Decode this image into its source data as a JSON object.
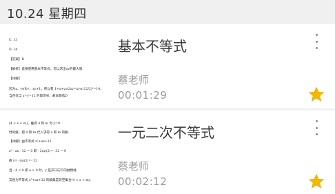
{
  "header": {
    "date_title": "10.24 星期四"
  },
  "cards": [
    {
      "topic": "基本不等式",
      "teacher": "蔡老师",
      "duration": "00:01:29",
      "more_icon": "more-vertical-icon",
      "star_icon": "star-icon",
      "star_color": "#f5b800",
      "thumb_lines": [
        "C. 13",
        "D. 14",
        "【答案】D",
        "【解析】直接使用基本不等式，可以求出xy的最大值.",
        "【详解】",
        "因为x，y∈R+，xy+1，所以有 1+x+y≥2xy=xy≤(12/2)²=14，",
        "当且仅当 x=y=12 时取等号，故本题选D"
      ]
    },
    {
      "topic": "一元二次不等式",
      "teacher": "蔡老师",
      "duration": "00:02:12",
      "more_icon": "more-vertical-icon",
      "star_icon": "star-icon",
      "star_color": "#f5b800",
      "thumb_lines": [
        "(4 < x < m)，推得 4 和 m 为 y=0",
        "时的解，把 4 和 m 代入求得 a 和 m 的解.",
        "【详解】由不等式 x²+ax+32",
        "x² - ax - 32 = 0 即 - 2(a)(2)=- 32 = 0",
        "故 y= -(a)(2)=- 32",
        "当 - 4 < 0 即 a > 0 时，y 是开口向下的抛物线.",
        "又因为不等式 x²+ax+32 的解集是非空集合(4 < x < m)."
      ]
    }
  ]
}
